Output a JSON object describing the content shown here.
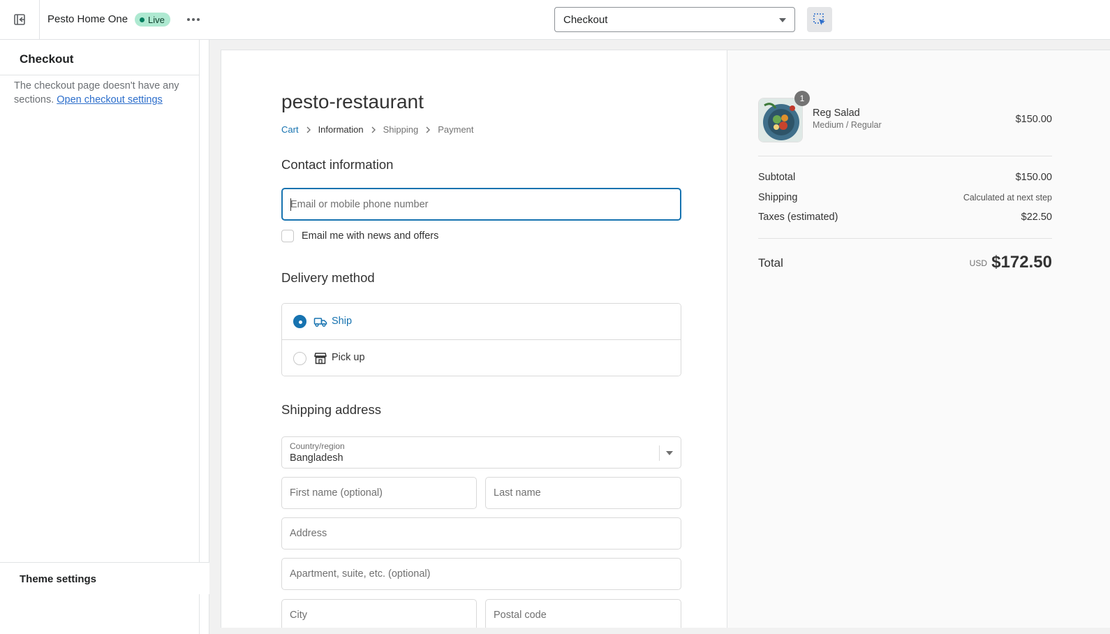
{
  "topbar": {
    "store_name": "Pesto Home One",
    "status_badge": "Live",
    "page_selector": "Checkout"
  },
  "sidebar": {
    "title": "Checkout",
    "message": "The checkout page doesn't have any sections.",
    "link": "Open checkout settings",
    "footer": "Theme settings"
  },
  "checkout": {
    "store_title": "pesto-restaurant",
    "breadcrumb": [
      "Cart",
      "Information",
      "Shipping",
      "Payment"
    ],
    "contact_heading": "Contact information",
    "email_placeholder": "Email or mobile phone number",
    "marketing_checkbox": "Email me with news and offers",
    "delivery_heading": "Delivery method",
    "delivery_options": [
      {
        "label": "Ship",
        "selected": true,
        "icon": "truck-icon"
      },
      {
        "label": "Pick up",
        "selected": false,
        "icon": "store-icon"
      }
    ],
    "shipping_heading": "Shipping address",
    "country_label": "Country/region",
    "country_value": "Bangladesh",
    "first_name_placeholder": "First name (optional)",
    "last_name_placeholder": "Last name",
    "address_placeholder": "Address",
    "apartment_placeholder": "Apartment, suite, etc. (optional)",
    "city_placeholder": "City",
    "postal_placeholder": "Postal code"
  },
  "summary": {
    "item": {
      "quantity": "1",
      "name": "Reg Salad",
      "variant": "Medium / Regular",
      "price": "$150.00"
    },
    "subtotal_label": "Subtotal",
    "subtotal_value": "$150.00",
    "shipping_label": "Shipping",
    "shipping_value": "Calculated at next step",
    "taxes_label": "Taxes (estimated)",
    "taxes_value": "$22.50",
    "total_label": "Total",
    "currency": "USD",
    "total_value": "$172.50"
  },
  "colors": {
    "accent": "#1773b0",
    "live_badge_bg": "#aee9d1"
  }
}
